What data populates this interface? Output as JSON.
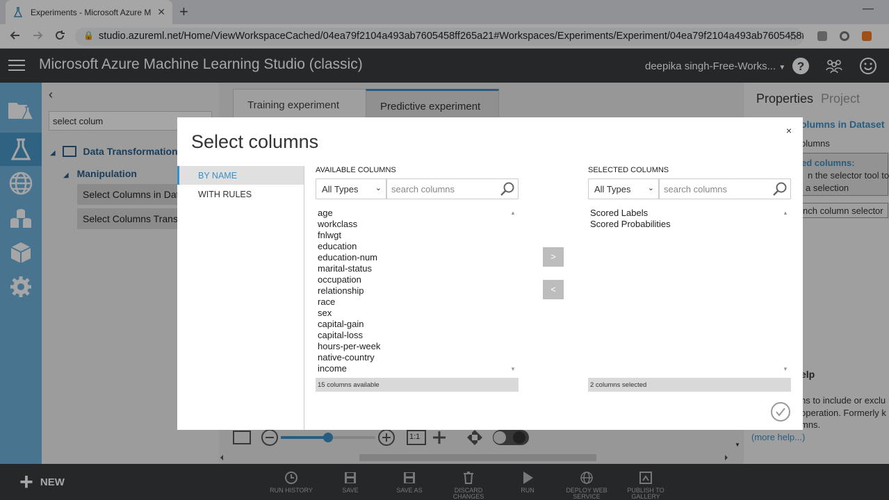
{
  "browser": {
    "tab_title": "Experiments - Microsoft Azure M",
    "tab_close": "✕",
    "new_tab": "+",
    "minimize": "—",
    "url": "studio.azureml.net/Home/ViewWorkspaceCached/04ea79f2104a493ab7605458ff265a21#Workspaces/Experiments/Experiment/04ea79f2104a493ab7605458f...",
    "colors": {
      "ext_orange": "#f47b20"
    }
  },
  "header": {
    "title": "Microsoft Azure Machine Learning Studio (classic)",
    "user": "deepika singh-Free-Works...",
    "help": "?"
  },
  "palette": {
    "search_value": "select colum",
    "tree": {
      "category": "Data Transformation",
      "subcategory": "Manipulation",
      "modules": [
        "Select Columns in Dataset",
        "Select Columns Transform"
      ]
    }
  },
  "experiment_tabs": [
    "Training experiment",
    "Predictive experiment"
  ],
  "properties": {
    "tabs": [
      "Properties",
      "Project"
    ],
    "module_title": "olumns in Dataset",
    "columns_label": "olumns",
    "selected_heading": "ed columns:",
    "hint_line1": "n the selector tool to",
    "hint_line2": "a selection",
    "launch": "nch column selector",
    "help_heading": "elp",
    "help_line1": "ns to include or exclu",
    "help_line2": " operation. Formerly k",
    "help_line3": "mns.",
    "more_help": "(more help...)"
  },
  "canvas_controls": {
    "fit_label": "1:1"
  },
  "bottom": {
    "new_label": "NEW",
    "commands": [
      {
        "line1": "RUN HISTORY",
        "line2": "",
        "icon": "history-icon"
      },
      {
        "line1": "SAVE",
        "line2": "",
        "icon": "save-icon"
      },
      {
        "line1": "SAVE AS",
        "line2": "",
        "icon": "save-as-icon"
      },
      {
        "line1": "DISCARD CHANGES",
        "line2": "",
        "icon": "trash-icon"
      },
      {
        "line1": "RUN",
        "line2": "",
        "icon": "play-icon"
      },
      {
        "line1": "DEPLOY WEB",
        "line2": "SERVICE",
        "icon": "globe-icon"
      },
      {
        "line1": "PUBLISH TO",
        "line2": "GALLERY",
        "icon": "publish-icon"
      }
    ]
  },
  "modal": {
    "title": "Select columns",
    "close": "×",
    "nav": [
      "BY NAME",
      "WITH RULES"
    ],
    "available": {
      "label": "AVAILABLE COLUMNS",
      "type_filter": "All Types",
      "search_placeholder": "search columns",
      "items": [
        "age",
        "workclass",
        "fnlwgt",
        "education",
        "education-num",
        "marital-status",
        "occupation",
        "relationship",
        "race",
        "sex",
        "capital-gain",
        "capital-loss",
        "hours-per-week",
        "native-country",
        "income"
      ],
      "status": "15 columns available"
    },
    "selected": {
      "label": "SELECTED COLUMNS",
      "type_filter": "All Types",
      "search_placeholder": "search columns",
      "items": [
        "Scored Labels",
        "Scored Probabilities"
      ],
      "status": "2 columns selected"
    },
    "add_label": ">",
    "remove_label": "<",
    "colors": {
      "accent": "#3c8fc6",
      "button_grey": "#bdbdbd"
    }
  }
}
